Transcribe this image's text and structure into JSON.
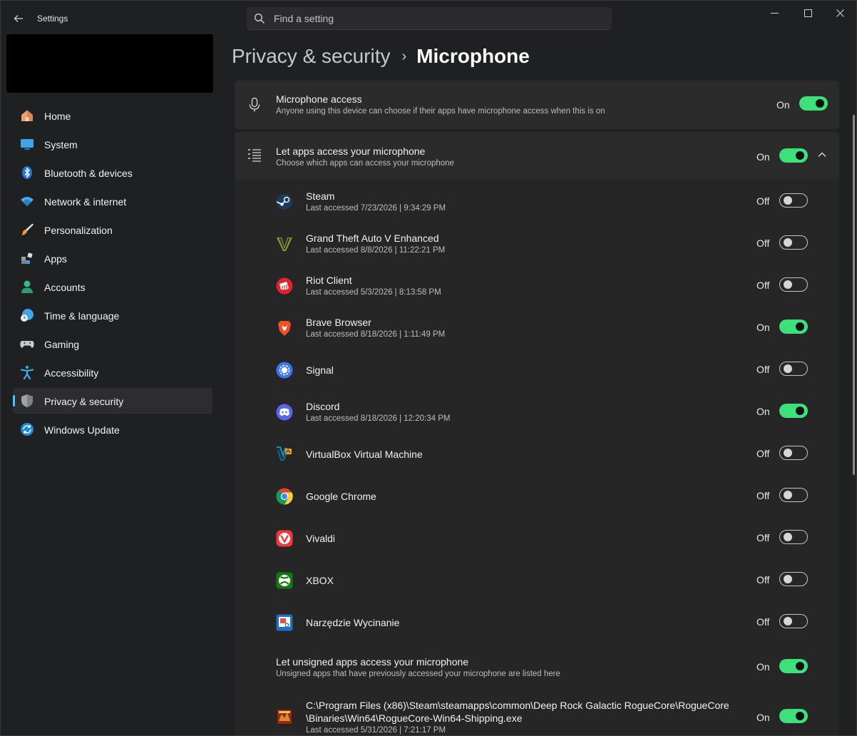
{
  "window": {
    "title": "Settings"
  },
  "search": {
    "placeholder": "Find a setting"
  },
  "sidebar": {
    "items": [
      {
        "label": "Home",
        "icon": "home-icon"
      },
      {
        "label": "System",
        "icon": "system-icon"
      },
      {
        "label": "Bluetooth & devices",
        "icon": "bluetooth-icon"
      },
      {
        "label": "Network & internet",
        "icon": "wifi-icon"
      },
      {
        "label": "Personalization",
        "icon": "brush-icon"
      },
      {
        "label": "Apps",
        "icon": "apps-icon"
      },
      {
        "label": "Accounts",
        "icon": "accounts-icon"
      },
      {
        "label": "Time & language",
        "icon": "clock-globe-icon"
      },
      {
        "label": "Gaming",
        "icon": "gamepad-icon"
      },
      {
        "label": "Accessibility",
        "icon": "accessibility-icon"
      },
      {
        "label": "Privacy & security",
        "icon": "shield-icon",
        "active": true
      },
      {
        "label": "Windows Update",
        "icon": "update-icon"
      }
    ]
  },
  "breadcrumb": {
    "parent": "Privacy & security",
    "current": "Microphone"
  },
  "mic_access": {
    "title": "Microphone access",
    "subtitle": "Anyone using this device can choose if their apps have microphone access when this is on",
    "state": "On"
  },
  "apps_access": {
    "title": "Let apps access your microphone",
    "subtitle": "Choose which apps can access your microphone",
    "state": "On"
  },
  "apps": [
    {
      "name": "Steam",
      "last": "Last accessed 7/23/2026  |  9:34:29 PM",
      "state": "Off",
      "icon": "steam-icon"
    },
    {
      "name": "Grand Theft Auto V Enhanced",
      "last": "Last accessed 8/8/2026  |  11:22:21 PM",
      "state": "Off",
      "icon": "gta-icon"
    },
    {
      "name": "Riot Client",
      "last": "Last accessed 5/3/2026  |  8:13:58 PM",
      "state": "Off",
      "icon": "riot-icon"
    },
    {
      "name": "Brave Browser",
      "last": "Last accessed 8/18/2026  |  1:11:49 PM",
      "state": "On",
      "icon": "brave-icon"
    },
    {
      "name": "Signal",
      "last": "",
      "state": "Off",
      "icon": "signal-icon"
    },
    {
      "name": "Discord",
      "last": "Last accessed 8/18/2026  |  12:20:34 PM",
      "state": "On",
      "icon": "discord-icon"
    },
    {
      "name": "VirtualBox Virtual Machine",
      "last": "",
      "state": "Off",
      "icon": "virtualbox-icon"
    },
    {
      "name": "Google Chrome",
      "last": "",
      "state": "Off",
      "icon": "chrome-icon"
    },
    {
      "name": "Vivaldi",
      "last": "",
      "state": "Off",
      "icon": "vivaldi-icon"
    },
    {
      "name": "XBOX",
      "last": "",
      "state": "Off",
      "icon": "xbox-icon"
    },
    {
      "name": "Narzędzie Wycinanie",
      "last": "",
      "state": "Off",
      "icon": "snipping-tool-icon"
    }
  ],
  "unsigned": {
    "title": "Let unsigned apps access your microphone",
    "subtitle": "Unsigned apps that have previously accessed your microphone are listed here",
    "state": "On"
  },
  "unsigned_app": {
    "path_line1": "C:\\Program Files (x86)\\Steam\\steamapps\\common\\Deep Rock Galactic RogueCore\\RogueCore",
    "path_line2": "\\Binaries\\Win64\\RogueCore-Win64-Shipping.exe",
    "last": "Last accessed 5/31/2026  |  7:21:17 PM",
    "state": "On",
    "icon": "roguecore-icon"
  },
  "colors": {
    "toggle_on": "#3ee07c",
    "accent": "#4cc2ff",
    "background": "#1f2022",
    "card": "#2b2b2b"
  }
}
